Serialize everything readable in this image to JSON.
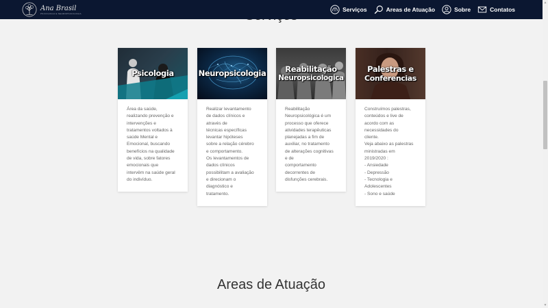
{
  "brand": {
    "name": "Ana Brasil",
    "tagline": "PSICOLOGIA E NEUROPSICOLOGIA"
  },
  "nav": [
    {
      "label": "Serviços",
      "icon": "brain-icon"
    },
    {
      "label": "Areas de Atuação",
      "icon": "magnifier-icon"
    },
    {
      "label": "Sobre",
      "icon": "user-icon"
    },
    {
      "label": "Contatos",
      "icon": "envelope-icon"
    }
  ],
  "section": {
    "title": "Serviços"
  },
  "cards": [
    {
      "title": "Psicologia",
      "text": "Área da saúde,\nrealizando prevenção e\nintervenções e\ntratamentos voltados à\nsaúde Mental e\nEmocional, buscando\nbenefícios na qualidade\nde vida, sobre fatores\nemocionais que\nintervêm na saúde geral\ndo indivíduo."
    },
    {
      "title": "Neuropsicologia",
      "text": "Realizar levantamento\nde dados clínicos e\natravés de\ntécnicas específicas\nlevantar hipóteses\nsobre a relação cérebro\ne comportamento.\nOs levantamentos de\ndados clínicos\npossibilitam a avaliação\ne direcionam o\ndiagnóstico e\ntratamento."
    },
    {
      "title_line1": "Reabilitação",
      "title_line2": "Neuropsicologica",
      "text": "Reabilitação\nNeuropsicológica é um\nprocesso que oferece\natividades terapêuticas\nplanejadas a fim de\nauxiliar, no tratamento\nde alterações cognitivas\ne de\ncomportamento\ndecorrentes de\ndisfunções cerebrais."
    },
    {
      "title_line1": "Palestras e",
      "title_line2": "Conferencias",
      "text": "Construímos palestras,\nconteúdos e live de\nacordo com as\nnecessidades do\ncliente.\nVeja abaixo as palestras\nministradas em\n2019/2020 :\n- Ansiedade\n- Depressão\n- Tecnologia e\nAdolescentes\n- Sono e saúde"
    }
  ],
  "areas": {
    "title": "Areas de Atuação"
  },
  "colors": {
    "navbar": "#0b1731",
    "background": "#f2f2f2",
    "card": "#ffffff"
  }
}
